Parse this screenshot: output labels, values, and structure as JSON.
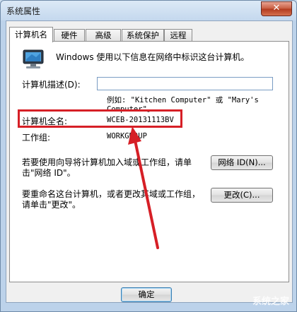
{
  "window": {
    "title": "系统属性",
    "close_label": "✕"
  },
  "tabs": [
    {
      "label": "计算机名",
      "active": true
    },
    {
      "label": "硬件",
      "active": false
    },
    {
      "label": "高级",
      "active": false
    },
    {
      "label": "系统保护",
      "active": false
    },
    {
      "label": "远程",
      "active": false
    }
  ],
  "intro": "Windows 使用以下信息在网络中标识这台计算机。",
  "description_label": "计算机描述(D):",
  "description_value": "",
  "example_line1": "例如: \"Kitchen Computer\" 或 \"Mary's",
  "example_line2": "Computer\"。",
  "full_name_label": "计算机全名:",
  "full_name_value": "WCEB-20131113BV",
  "workgroup_label": "工作组:",
  "workgroup_value": "WORKGROUP",
  "network_text_line1": "若要使用向导将计算机加入域或工作组，请单",
  "network_text_line2": "击\"网络 ID\"。",
  "network_id_button": "网络 ID(N)...",
  "rename_text_line1": "要重命名这台计算机，或者更改其域或工作组，",
  "rename_text_line2": "请单击\"更改\"。",
  "change_button": "更改(C)...",
  "ok_button": "确定",
  "watermark": "系统之家",
  "colors": {
    "highlight": "#d61f26",
    "arrow": "#d61f26"
  }
}
